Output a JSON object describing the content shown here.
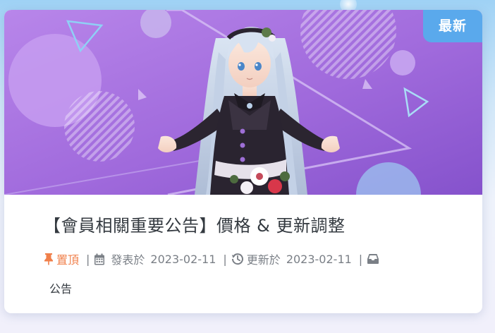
{
  "post": {
    "badge": "最新",
    "title": "【會員相關重要公告】價格 & 更新調整",
    "pinned_label": "置頂",
    "separator": "|",
    "published_label": "發表於",
    "published_date": "2023-02-11",
    "updated_label": "更新於",
    "updated_date": "2023-02-11",
    "category": "公告"
  },
  "colors": {
    "badge_bg": "#5aa9ec",
    "pinned": "#f07f4a",
    "title": "#343a40",
    "meta": "#7a7f86",
    "cover_gradient": [
      "#b27ee8",
      "#9a62d8",
      "#7f4fc9"
    ]
  },
  "icons": {
    "pinned": "thumbtack-icon",
    "published": "calendar-icon",
    "updated": "history-icon",
    "category": "inbox-icon"
  }
}
